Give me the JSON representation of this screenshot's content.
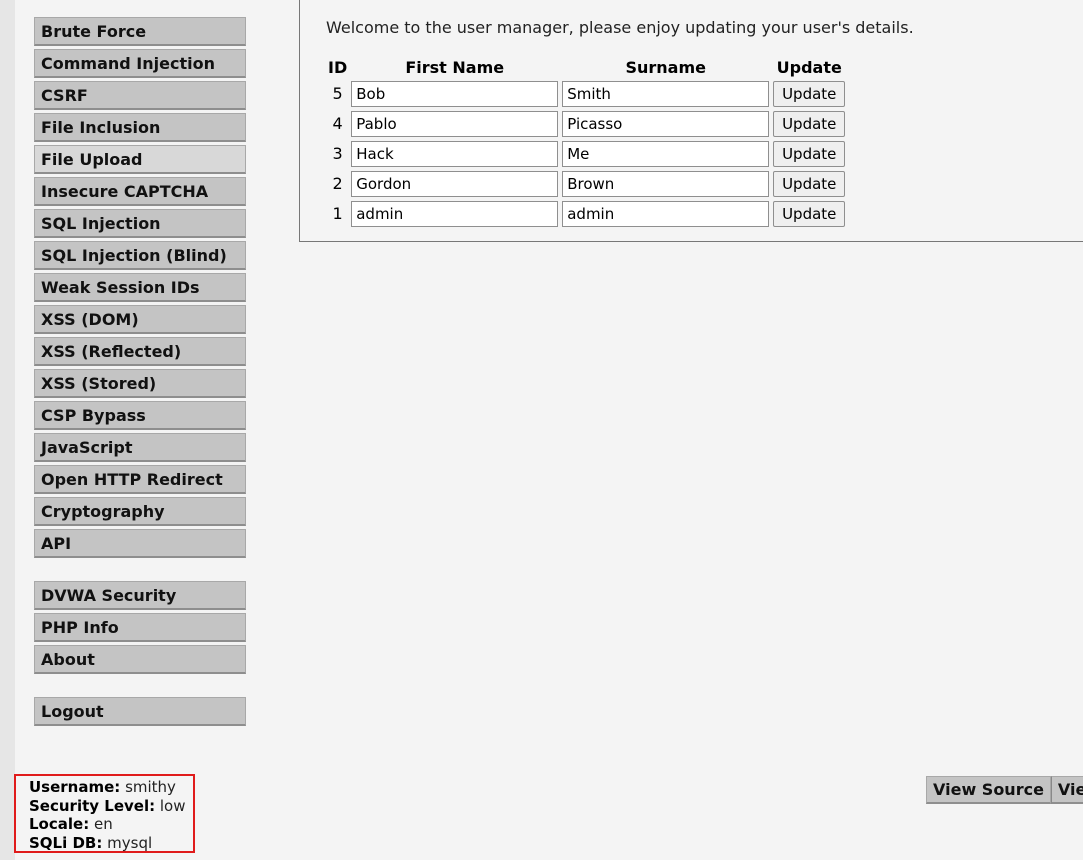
{
  "menu": {
    "group1": [
      {
        "label": "Brute Force",
        "name": "brute-force"
      },
      {
        "label": "Command Injection",
        "name": "command-injection"
      },
      {
        "label": "CSRF",
        "name": "csrf"
      },
      {
        "label": "File Inclusion",
        "name": "file-inclusion"
      },
      {
        "label": "File Upload",
        "name": "file-upload"
      },
      {
        "label": "Insecure CAPTCHA",
        "name": "insecure-captcha"
      },
      {
        "label": "SQL Injection",
        "name": "sql-injection"
      },
      {
        "label": "SQL Injection (Blind)",
        "name": "sql-injection-blind"
      },
      {
        "label": "Weak Session IDs",
        "name": "weak-session-ids"
      },
      {
        "label": "XSS (DOM)",
        "name": "xss-dom"
      },
      {
        "label": "XSS (Reflected)",
        "name": "xss-reflected"
      },
      {
        "label": "XSS (Stored)",
        "name": "xss-stored"
      },
      {
        "label": "CSP Bypass",
        "name": "csp-bypass"
      },
      {
        "label": "JavaScript",
        "name": "javascript"
      },
      {
        "label": "Open HTTP Redirect",
        "name": "open-http-redirect"
      },
      {
        "label": "Cryptography",
        "name": "cryptography"
      },
      {
        "label": "API",
        "name": "api"
      }
    ],
    "group2": [
      {
        "label": "DVWA Security",
        "name": "dvwa-security"
      },
      {
        "label": "PHP Info",
        "name": "php-info"
      },
      {
        "label": "About",
        "name": "about"
      }
    ],
    "group3": [
      {
        "label": "Logout",
        "name": "logout"
      }
    ]
  },
  "main": {
    "welcome": "Welcome to the user manager, please enjoy updating your user's details.",
    "table": {
      "headers": {
        "id": "ID",
        "first_name": "First Name",
        "surname": "Surname",
        "update": "Update"
      },
      "rows": [
        {
          "id": "5",
          "first_name": "Bob",
          "surname": "Smith",
          "button": "Update"
        },
        {
          "id": "4",
          "first_name": "Pablo",
          "surname": "Picasso",
          "button": "Update"
        },
        {
          "id": "3",
          "first_name": "Hack",
          "surname": "Me",
          "button": "Update"
        },
        {
          "id": "2",
          "first_name": "Gordon",
          "surname": "Brown",
          "button": "Update"
        },
        {
          "id": "1",
          "first_name": "admin",
          "surname": "admin",
          "button": "Update"
        }
      ]
    }
  },
  "info": {
    "username_label": "Username:",
    "username": "smithy",
    "security_label": "Security Level:",
    "security": "low",
    "locale_label": "Locale:",
    "locale": "en",
    "sqli_label": "SQLi DB:",
    "sqli": "mysql"
  },
  "source_buttons": {
    "view_source": "View Source",
    "view_help": "View"
  },
  "colors": {
    "menu_bg": "#c4c4c4",
    "highlight_box": "#e01b1b"
  }
}
